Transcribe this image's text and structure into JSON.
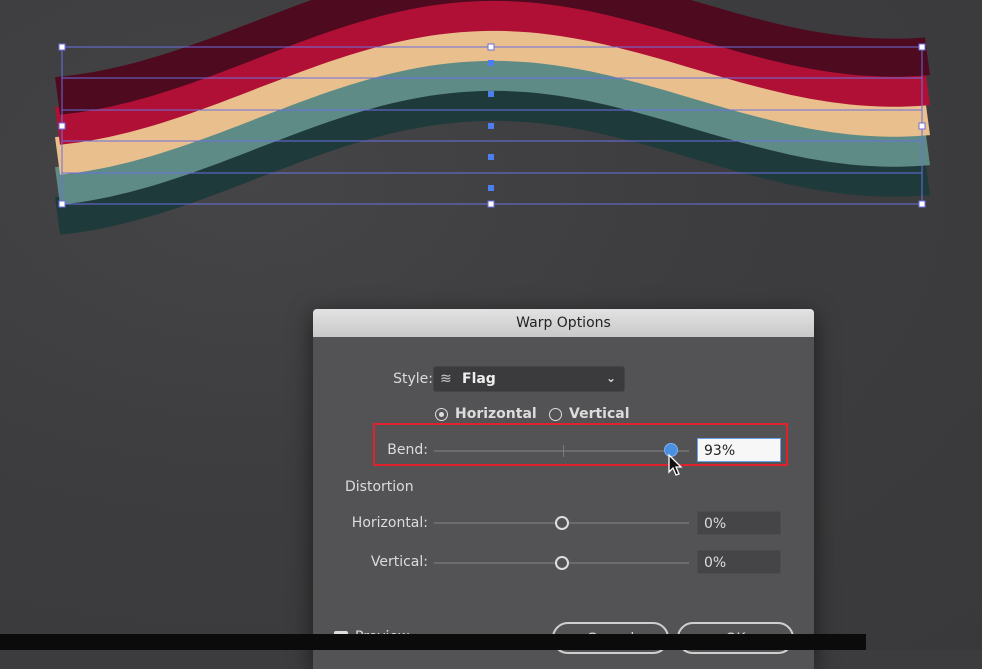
{
  "dialog": {
    "title": "Warp Options",
    "style_label": "Style:",
    "style_value": "Flag",
    "style_icon": "flag-warp-icon",
    "orientation": {
      "horizontal_label": "Horizontal",
      "vertical_label": "Vertical",
      "selected": "Horizontal"
    },
    "bend": {
      "label": "Bend:",
      "value": "93%",
      "fraction": 0.93
    },
    "distortion": {
      "heading": "Distortion",
      "horizontal": {
        "label": "Horizontal:",
        "value": "0%",
        "fraction": 0.0
      },
      "vertical": {
        "label": "Vertical:",
        "value": "0%",
        "fraction": 0.0
      }
    },
    "preview": {
      "label": "Preview",
      "checked": true
    },
    "cancel_label": "Cancel",
    "ok_label": "OK"
  },
  "colors": {
    "band_dark_red": "#4e0a1e",
    "band_crimson": "#b01036",
    "band_peach": "#e9bf8d",
    "band_teal": "#5e8b85",
    "band_dark_teal": "#1f3a3b",
    "selection": "#6b6fe0",
    "highlight_box": "#e0222d",
    "slider_active": "#4a8fe0"
  }
}
